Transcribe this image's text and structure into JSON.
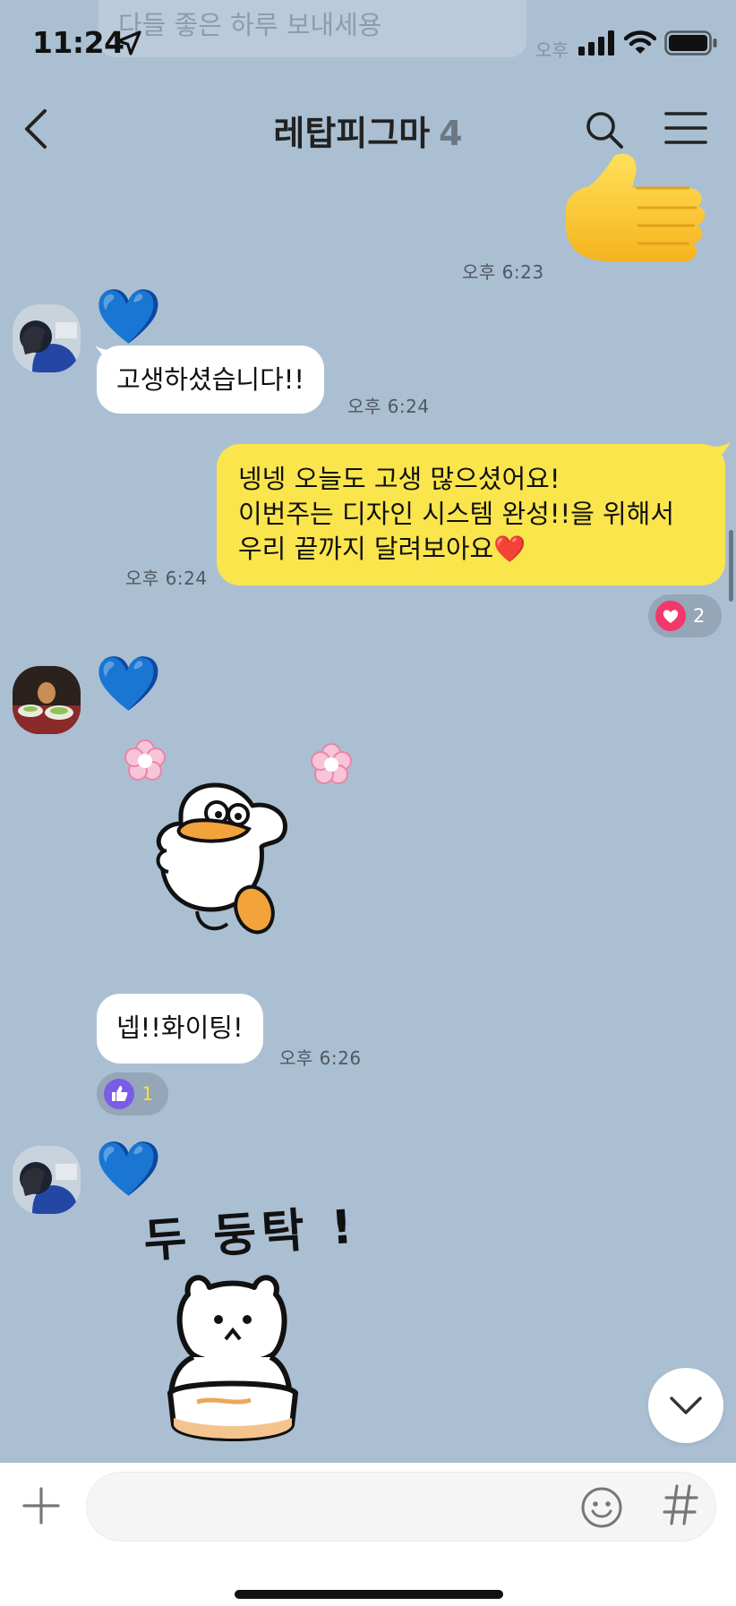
{
  "status_bar": {
    "time": "11:24"
  },
  "previous_message": {
    "text": "다들 좋은 하루 보내세용"
  },
  "header": {
    "title": "레탑피그마",
    "member_count": "4"
  },
  "messages": [
    {
      "type": "sticker-sent",
      "sticker": "thumbs-up",
      "glyph": "👍",
      "time": "오후 6:23"
    },
    {
      "type": "received",
      "sender_badge": "💙",
      "text": "고생하셨습니다!!",
      "time": "오후 6:24"
    },
    {
      "type": "sent",
      "text": "넹넹 오늘도 고생 많으셨어요!\n이번주는 디자인 시스템 완성!!을 위해서\n우리 끝까지 달려보아요❤️",
      "time": "오후 6:24",
      "reaction": {
        "icon": "heart-icon",
        "count": "2"
      }
    },
    {
      "type": "received-sticker",
      "sender_badge": "💙",
      "sticker": "duck-with-flowers"
    },
    {
      "type": "received",
      "text": "넵!!화이팅!",
      "time": "오후 6:26",
      "reaction": {
        "icon": "thumbs-up-icon",
        "count": "1"
      }
    },
    {
      "type": "received-sticker",
      "sender_badge": "💙",
      "sticker": "bear-dudungtak",
      "sticker_text": "두 둥탁 !"
    }
  ],
  "composer": {
    "placeholder": "",
    "value": ""
  },
  "colors": {
    "chat_background": "#abbfd2",
    "sent_bubble": "#fae54d",
    "received_bubble": "#ffffff",
    "heart_reaction": "#f2386b",
    "like_reaction": "#7a5ce6"
  }
}
